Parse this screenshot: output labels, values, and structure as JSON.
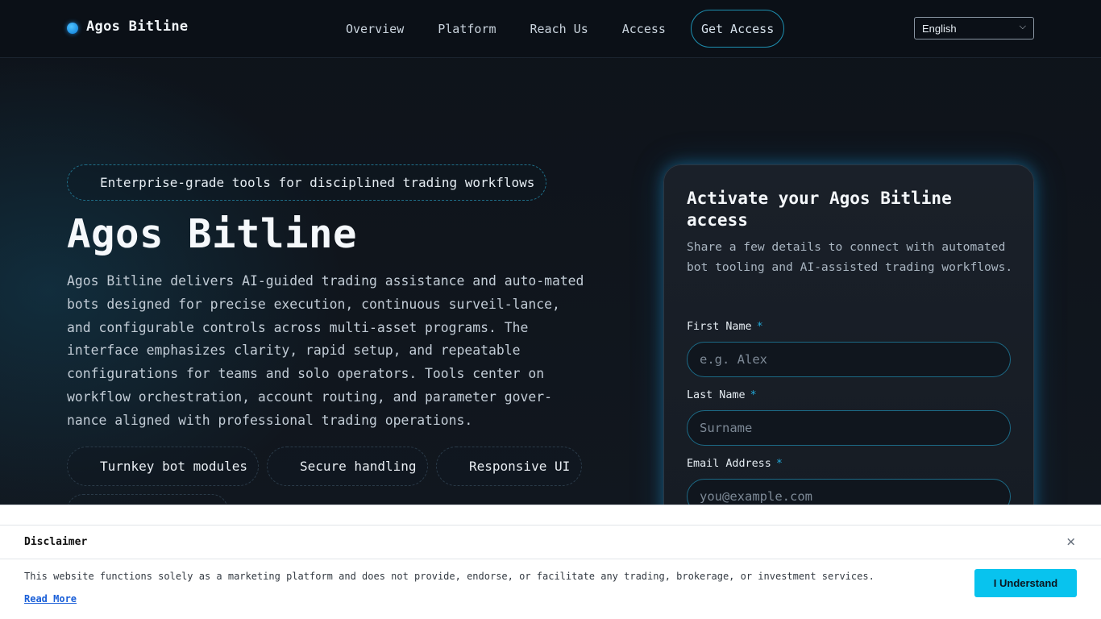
{
  "header": {
    "brand": "Agos Bitline",
    "nav": [
      "Overview",
      "Platform",
      "Reach Us",
      "Access"
    ],
    "cta": "Get Access",
    "language": "English"
  },
  "hero": {
    "badge": "Enterprise-grade tools for disciplined trading workflows",
    "title": "Agos Bitline",
    "description": "Agos Bitline delivers AI-guided trading assistance and auto-mated bots designed for precise execution, continuous surveil-lance, and configurable controls across multi-asset programs. The interface emphasizes clarity, rapid setup, and repeatable configurations for teams and solo operators. Tools center on workflow orchestration, account routing, and parameter gover-nance aligned with professional trading operations.",
    "features": [
      "Turnkey bot modules",
      "Secure handling",
      "Responsive UI"
    ]
  },
  "form": {
    "title": "Activate your Agos Bitline access",
    "subtitle": "Share a few details to connect with automated bot tooling and AI-assisted trading workflows.",
    "fields": [
      {
        "label": "First Name",
        "required": "*",
        "placeholder": "e.g. Alex"
      },
      {
        "label": "Last Name",
        "required": "*",
        "placeholder": "Surname"
      },
      {
        "label": "Email Address",
        "required": "*",
        "placeholder": "you@example.com"
      }
    ]
  },
  "disclaimer": {
    "title": "Disclaimer",
    "close": "×",
    "text": "This website functions solely as a marketing platform and does not provide, endorse, or facilitate any trading, brokerage, or investment services.",
    "link": "Read More",
    "button": "I Understand"
  }
}
